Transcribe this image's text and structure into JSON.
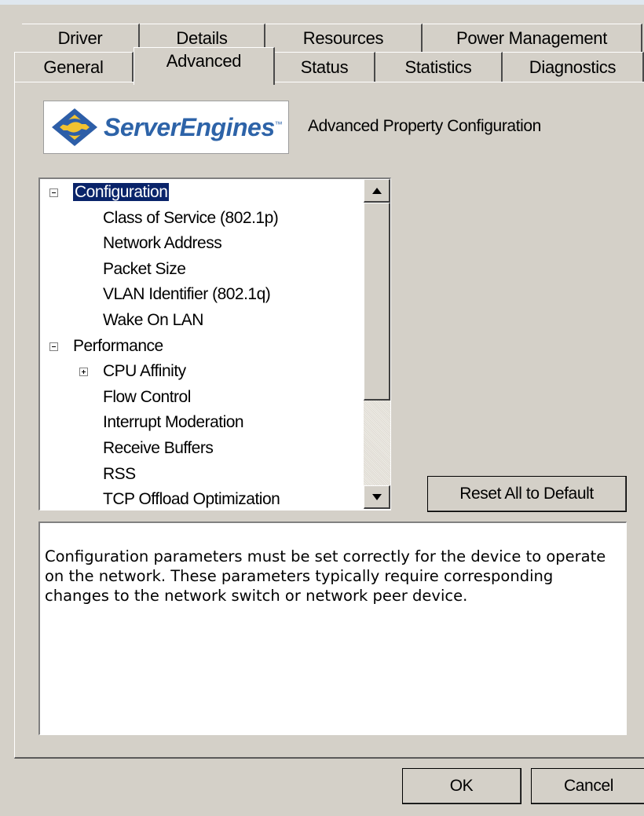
{
  "tabs": {
    "row1": [
      "Driver",
      "Details",
      "Resources",
      "Power Management"
    ],
    "row2": [
      "General",
      "Advanced",
      "Status",
      "Statistics",
      "Diagnostics"
    ],
    "active": "Advanced"
  },
  "header": {
    "logo_text": "ServerEngines",
    "logo_tm": "™",
    "title": "Advanced Property Configuration"
  },
  "tree": {
    "items": [
      {
        "label": "Configuration",
        "expander": "minus",
        "level": 0,
        "selected": true
      },
      {
        "label": "Class of Service (802.1p)",
        "level": 2
      },
      {
        "label": "Network Address",
        "level": 2
      },
      {
        "label": "Packet Size",
        "level": 2
      },
      {
        "label": "VLAN Identifier (802.1q)",
        "level": 2
      },
      {
        "label": "Wake On LAN",
        "level": 2
      },
      {
        "label": "Performance",
        "expander": "minus",
        "level": 0
      },
      {
        "label": "CPU Affinity",
        "expander": "plus",
        "level": 1
      },
      {
        "label": "Flow Control",
        "level": 2
      },
      {
        "label": "Interrupt Moderation",
        "level": 2
      },
      {
        "label": "Receive Buffers",
        "level": 2
      },
      {
        "label": "RSS",
        "level": 2
      },
      {
        "label": "TCP Offload Optimization",
        "level": 2
      }
    ]
  },
  "buttons": {
    "reset": "Reset All to Default",
    "ok": "OK",
    "cancel": "Cancel"
  },
  "description": "Configuration parameters must be set correctly for the device to operate on the network.  These parameters typically require corresponding changes to the network switch or network peer device.",
  "colors": {
    "dialog_bg": "#d4d0c8",
    "selection_bg": "#0a246a",
    "logo_blue": "#2d63a8",
    "logo_yellow": "#f2c230"
  },
  "icons": [
    "collapse-icon",
    "expand-icon",
    "scroll-up-arrow-icon",
    "scroll-down-arrow-icon",
    "serverengines-logo-icon"
  ]
}
